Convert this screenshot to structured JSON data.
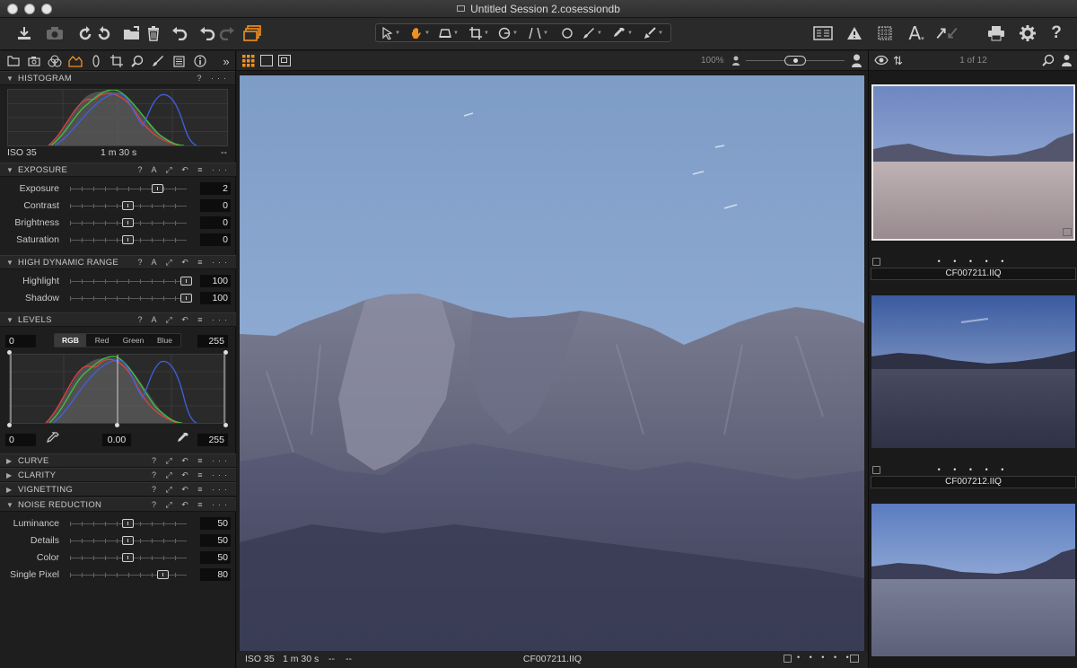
{
  "window": {
    "title": "Untitled Session 2.cosessiondb"
  },
  "toolbar": {
    "left_icons": [
      "import-icon",
      "camera-icon",
      "rotate-left-icon",
      "rotate-right-icon",
      "folder-move-icon",
      "trash-icon",
      "undo-icon",
      "back-icon",
      "forward-icon",
      "variants-icon"
    ],
    "cursor_tools": [
      "select-cursor-icon",
      "pan-hand-icon",
      "loupe-icon",
      "crop-icon",
      "rotate-tool-icon",
      "keystone-icon",
      "spot-icon",
      "brush-icon",
      "eyedropper-icon",
      "apply-icon"
    ],
    "right_icons": [
      "viewer-layout-icon",
      "warning-icon",
      "grid-icon",
      "text-overlay-icon",
      "copy-adjust-icon",
      "print-icon",
      "settings-icon",
      "help-icon"
    ]
  },
  "left_panel": {
    "tabs": [
      "folder-tab-icon",
      "camera-tab-icon",
      "color-tab-icon",
      "exposure-tab-icon",
      "lens-tab-icon",
      "crop-tab-icon",
      "search-tab-icon",
      "brush-tab-icon",
      "metadata-tab-icon",
      "info-tab-icon"
    ],
    "expand_label": "»",
    "histogram": {
      "title": "HISTOGRAM",
      "iso": "ISO 35",
      "shutter": "1 m 30 s",
      "aperture": "--",
      "help": "?"
    },
    "exposure": {
      "title": "EXPOSURE",
      "header_icons": "? A ⤢ ↶ ≡ ···",
      "sliders": [
        {
          "label": "Exposure",
          "value": "2",
          "position": 0.75
        },
        {
          "label": "Contrast",
          "value": "0",
          "position": 0.5
        },
        {
          "label": "Brightness",
          "value": "0",
          "position": 0.5
        },
        {
          "label": "Saturation",
          "value": "0",
          "position": 0.5
        }
      ]
    },
    "hdr": {
      "title": "HIGH DYNAMIC RANGE",
      "header_icons": "? A ⤢ ↶ ≡ ···",
      "sliders": [
        {
          "label": "Highlight",
          "value": "100",
          "position": 1.0
        },
        {
          "label": "Shadow",
          "value": "100",
          "position": 1.0
        }
      ]
    },
    "levels": {
      "title": "LEVELS",
      "header_icons": "? A ⤢ ↶ ≡ ···",
      "low_input": "0",
      "high_input": "255",
      "channels": [
        "RGB",
        "Red",
        "Green",
        "Blue"
      ],
      "active_channel": "RGB",
      "low_output": "0",
      "mid_value": "0.00",
      "high_output": "255"
    },
    "collapsed_sections": [
      {
        "title": "CURVE",
        "icons": "? ⤢ ↶ ≡ ···"
      },
      {
        "title": "CLARITY",
        "icons": "? ⤢ ↶ ≡ ···"
      },
      {
        "title": "VIGNETTING",
        "icons": "? ⤢ ↶ ≡ ···"
      }
    ],
    "noise_reduction": {
      "title": "NOISE REDUCTION",
      "header_icons": "? ⤢ ↶ ≡ ···",
      "sliders": [
        {
          "label": "Luminance",
          "value": "50",
          "position": 0.5
        },
        {
          "label": "Details",
          "value": "50",
          "position": 0.5
        },
        {
          "label": "Color",
          "value": "50",
          "position": 0.5
        },
        {
          "label": "Single Pixel",
          "value": "80",
          "position": 0.8
        }
      ]
    }
  },
  "viewer": {
    "zoom": "100%",
    "footer": {
      "iso": "ISO 35",
      "shutter": "1 m 30 s",
      "aperture": "--",
      "focal": "--",
      "filename": "CF007211.IIQ"
    },
    "footer_dots": "• • • • •"
  },
  "browser": {
    "count": "1 of 12",
    "thumbnails": [
      {
        "name": "CF007211.IIQ",
        "selected": true,
        "dots": "• • • • •"
      },
      {
        "name": "CF007212.IIQ",
        "selected": false,
        "dots": "• • • • •"
      },
      {
        "name": "",
        "selected": false,
        "dots": ""
      }
    ]
  },
  "colors": {
    "accent": "#f09020",
    "panel": "#1e1e1e",
    "value_box": "#0d0d0d"
  }
}
